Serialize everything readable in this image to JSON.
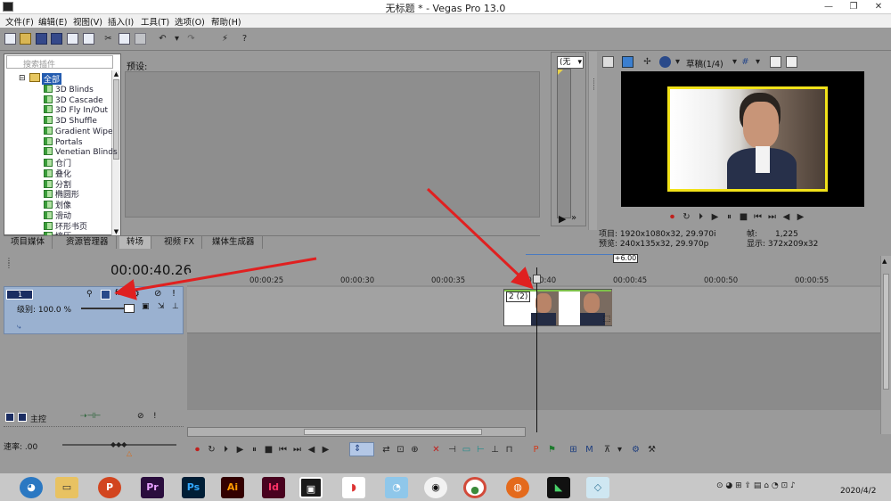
{
  "window": {
    "title": "无标题 * - Vegas Pro 13.0"
  },
  "menu": [
    "文件(F)",
    "编辑(E)",
    "视图(V)",
    "插入(I)",
    "工具(T)",
    "选项(O)",
    "帮助(H)"
  ],
  "plugin_panel": {
    "search_placeholder": "搜索插件",
    "root": "全部",
    "items": [
      "3D Blinds",
      "3D Cascade",
      "3D Fly In/Out",
      "3D Shuffle",
      "Gradient Wipe",
      "Portals",
      "Venetian Blinds",
      "仓门",
      "叠化",
      "分割",
      "椭圆形",
      "划像",
      "滑动",
      "环形书页",
      "挤压"
    ]
  },
  "preset_label": "预设:",
  "tabs": [
    "项目媒体",
    "资源管理器",
    "转场",
    "视频 FX",
    "媒体生成器"
  ],
  "active_tab": "转场",
  "mid_panel": {
    "selector": "(无"
  },
  "preview": {
    "quality": "草稿(1/4)",
    "project_label": "项目: 1920x1080x32, 29.970i",
    "preview_label": "预览: 240x135x32, 29.970p",
    "frame_label": "帧:",
    "frame_value": "1,225",
    "display_label": "显示: 372x209x32"
  },
  "timeline": {
    "timecode": "00:00:40.26",
    "offset": "+6.00",
    "ruler": [
      "00:00:25",
      "00:00:30",
      "00:00:35",
      "00:00:40",
      "00:00:45",
      "00:00:50",
      "00:00:55"
    ],
    "track_number": "1",
    "level_label": "级别: 100.0 %",
    "clip_label": "2 (2)",
    "master_label": "主控",
    "rate_label": "速率: .00"
  },
  "clock": {
    "date": "2020/4/2"
  }
}
